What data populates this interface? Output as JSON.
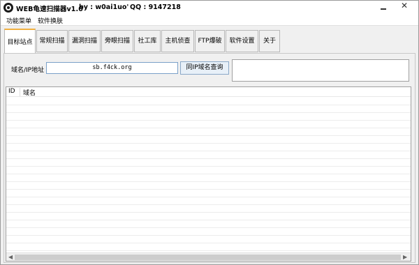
{
  "window": {
    "title": "WEB龟速扫描器v1.0",
    "author": "by : w0ai1uo'",
    "qq": "QQ : 9147218"
  },
  "menu": [
    "功能菜单",
    "软件换肤"
  ],
  "tabs": [
    {
      "label": "目标站点",
      "active": true
    },
    {
      "label": "常规扫描",
      "active": false
    },
    {
      "label": "漏洞扫描",
      "active": false
    },
    {
      "label": "旁眼扫描",
      "active": false
    },
    {
      "label": "社工库",
      "active": false
    },
    {
      "label": "主机侦查",
      "active": false
    },
    {
      "label": "FTP爆破",
      "active": false
    },
    {
      "label": "软件设置",
      "active": false
    },
    {
      "label": "关于",
      "active": false
    }
  ],
  "target": {
    "domain_label": "域名/IP地址",
    "domain_value": "sb.f4ck.org",
    "query_button": "同IP域名查询"
  },
  "results_table": {
    "columns": [
      "ID",
      "域名"
    ],
    "rows": []
  },
  "icons": {
    "app": "app-logo-icon",
    "minimize": "minimize-icon",
    "close": "close-icon"
  },
  "colors": {
    "active_tab_accent": "#f0b040",
    "input_border": "#7aa0c8",
    "button_bg": "#e8f0f8"
  }
}
